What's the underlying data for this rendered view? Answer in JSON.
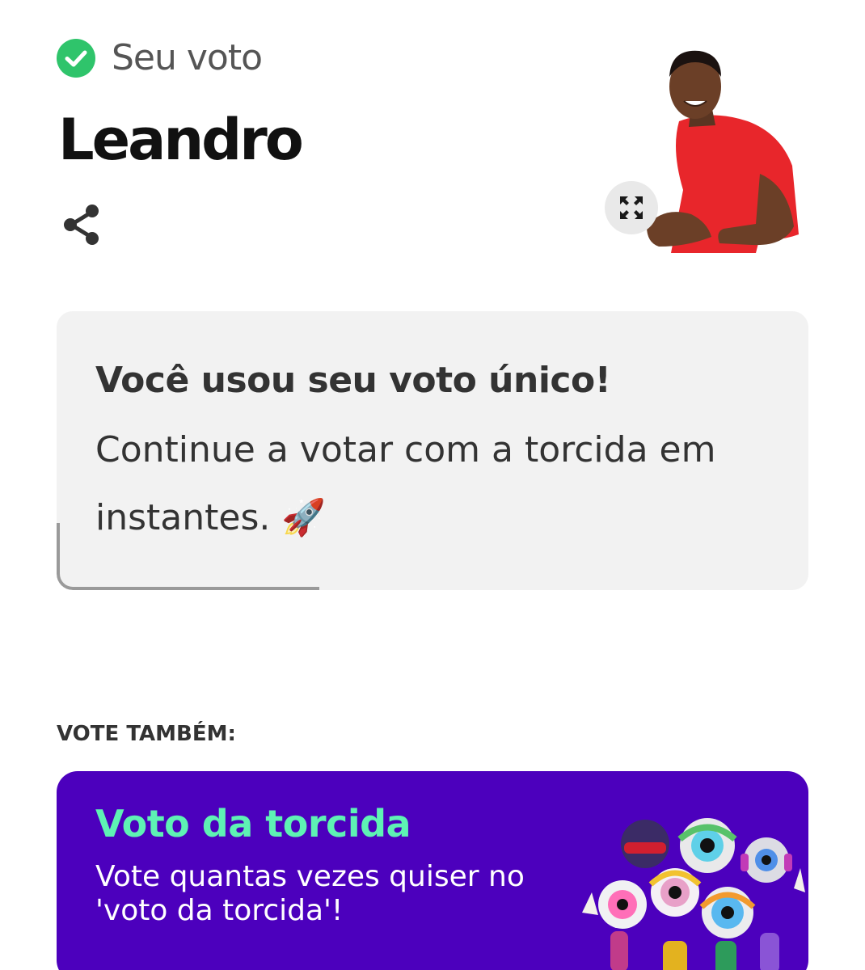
{
  "header": {
    "voted_label": "Seu voto",
    "candidate_name": "Leandro",
    "check_icon": "check-circle-icon",
    "share_icon": "share-icon",
    "expand_icon": "expand-icon"
  },
  "info_card": {
    "title": "Você usou seu voto único!",
    "text": "Continue a votar com a torcida em instantes. 🚀"
  },
  "vote_also_label": "VOTE TAMBÉM:",
  "promo": {
    "title": "Voto da torcida",
    "text": "Vote quantas vezes quiser no 'voto da torcida'!"
  },
  "colors": {
    "check_green": "#2fc46b",
    "promo_bg": "#4c00bd",
    "promo_title": "#5ef2b4",
    "card_bg": "#f2f2f2"
  }
}
